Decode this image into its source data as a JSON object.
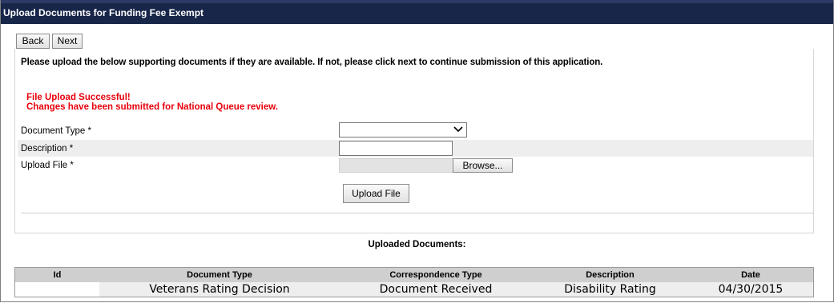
{
  "window": {
    "title": "Upload Documents for Funding Fee Exempt"
  },
  "nav": {
    "back_label": "Back",
    "next_label": "Next"
  },
  "instructions": "Please upload the below supporting documents if they are available. If not, please click next to continue submission of this application.",
  "messages": {
    "success": "File Upload Successful!",
    "submitted": "Changes have been submitted for National Queue review."
  },
  "form": {
    "document_type_label": "Document Type *",
    "document_type_value": "",
    "description_label": "Description *",
    "description_value": "",
    "upload_file_label": "Upload File *",
    "browse_label": "Browse...",
    "upload_button_label": "Upload File"
  },
  "uploaded": {
    "title": "Uploaded Documents:",
    "columns": [
      "Id",
      "Document Type",
      "Correspondence Type",
      "Description",
      "Date"
    ],
    "rows": [
      [
        "",
        "Veterans Rating Decision",
        "Document Received",
        "Disability Rating",
        "04/30/2015"
      ]
    ]
  },
  "colors": {
    "titlebar": "#18264a",
    "message": "#e8000b"
  }
}
